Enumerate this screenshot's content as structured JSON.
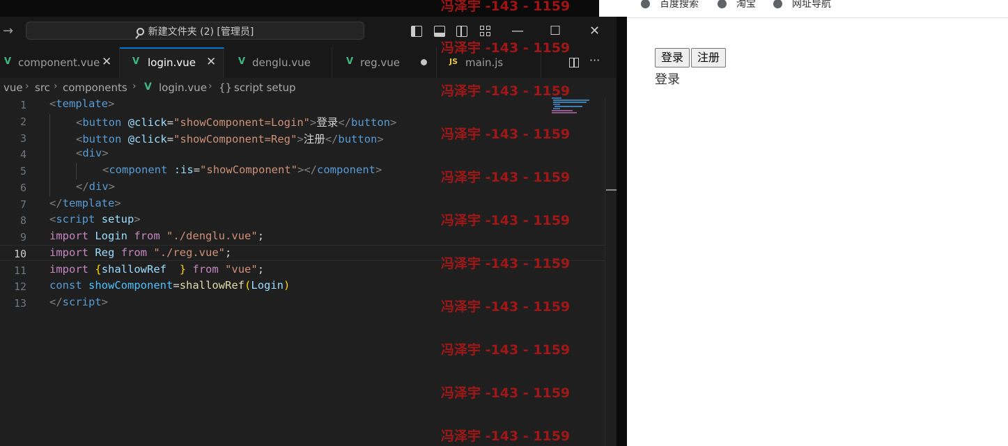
{
  "window": {
    "title": "新建文件夹 (2) [管理员]",
    "controls": {
      "minimize": "—",
      "maximize": "☐",
      "close": "✕"
    }
  },
  "tabs": [
    {
      "label": "component.vue",
      "icon": "vue-icon",
      "close": "✕",
      "active": false
    },
    {
      "label": "login.vue",
      "icon": "vue-icon",
      "close": "✕",
      "active": true
    },
    {
      "label": "denglu.vue",
      "icon": "vue-icon",
      "active": false
    },
    {
      "label": "reg.vue",
      "icon": "vue-icon",
      "modified": true,
      "active": false
    },
    {
      "label": "main.js",
      "icon": "js-icon",
      "badge": "JS",
      "active": false
    }
  ],
  "tab_actions": {
    "more": "···"
  },
  "breadcrumb": {
    "items": [
      "vue",
      "src",
      "components",
      "login.vue",
      "script setup"
    ],
    "symbol": "{}",
    "separator": "›"
  },
  "editor": {
    "current_line": 10,
    "line_numbers": [
      "1",
      "2",
      "3",
      "4",
      "5",
      "6",
      "7",
      "8",
      "9",
      "10",
      "11",
      "12",
      "13"
    ]
  },
  "code": {
    "l1": [
      "<",
      "template",
      ">"
    ],
    "l2": [
      "<",
      "button",
      " ",
      "@click",
      "=",
      "\"showComponent=Login\"",
      ">",
      "登录",
      "</",
      "button",
      ">"
    ],
    "l3": [
      "<",
      "button",
      " ",
      "@click",
      "=",
      "\"showComponent=Reg\"",
      ">",
      "注册",
      "</",
      "button",
      ">"
    ],
    "l4": [
      "<",
      "div",
      ">"
    ],
    "l5": [
      "<",
      "component",
      " ",
      ":is",
      "=",
      "\"showComponent\"",
      "></",
      "component",
      ">"
    ],
    "l6": [
      "</",
      "div",
      ">"
    ],
    "l7": [
      "</",
      "template",
      ">"
    ],
    "l8": [
      "<",
      "script",
      " ",
      "setup",
      ">"
    ],
    "l9": [
      "import",
      " ",
      "Login",
      " ",
      "from",
      " ",
      "\"./denglu.vue\"",
      ";"
    ],
    "l10": [
      "import",
      " ",
      "Reg",
      " ",
      "from",
      " ",
      "\"./reg.vue\"",
      ";"
    ],
    "l11": [
      "import",
      " ",
      "{",
      "shallowRef",
      "  ",
      "}",
      " ",
      "from",
      " ",
      "\"vue\"",
      ";"
    ],
    "l12": [
      "const",
      " ",
      "showComponent",
      "=",
      "shallowRef",
      "(",
      "Login",
      ")"
    ],
    "l13": [
      "</",
      "script",
      ">"
    ]
  },
  "watermark": "冯泽宇 -143 - 1159",
  "browser": {
    "bookmarks": [
      "百度搜索",
      "淘宝",
      "网址导航"
    ],
    "buttons": [
      "登录",
      "注册"
    ],
    "content_text": "登录"
  },
  "colors": {
    "editor_bg": "#1f1f1f",
    "tab_active_border": "#0078d4",
    "vue_green": "#41b883",
    "watermark_red": "#b01717"
  }
}
